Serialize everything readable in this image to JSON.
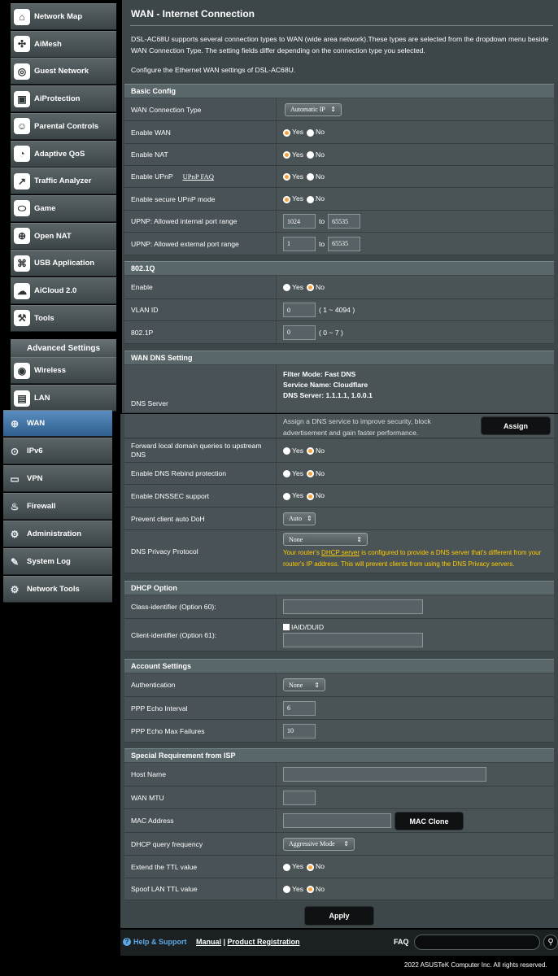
{
  "sidebar_top": [
    {
      "label": "Network Map",
      "icon": "network-map-icon",
      "glyph": "⌂"
    },
    {
      "label": "AiMesh",
      "icon": "aimesh-icon",
      "glyph": "✣"
    },
    {
      "label": "Guest Network",
      "icon": "guest-network-icon",
      "glyph": "◎"
    },
    {
      "label": "AiProtection",
      "icon": "aiprotection-icon",
      "glyph": "▣"
    },
    {
      "label": "Parental Controls",
      "icon": "parental-controls-icon",
      "glyph": "☺"
    },
    {
      "label": "Adaptive QoS",
      "icon": "adaptive-qos-icon",
      "glyph": "◔"
    },
    {
      "label": "Traffic Analyzer",
      "icon": "traffic-analyzer-icon",
      "glyph": "↗"
    },
    {
      "label": "Game",
      "icon": "game-icon",
      "glyph": "⬭"
    },
    {
      "label": "Open NAT",
      "icon": "open-nat-icon",
      "glyph": "⊕"
    },
    {
      "label": "USB Application",
      "icon": "usb-application-icon",
      "glyph": "⌘"
    },
    {
      "label": "AiCloud 2.0",
      "icon": "aicloud-icon",
      "glyph": "☁"
    },
    {
      "label": "Tools",
      "icon": "tools-icon",
      "glyph": "⚒"
    }
  ],
  "advanced_settings": "Advanced Settings",
  "sidebar_adv_top": [
    {
      "label": "Wireless",
      "icon": "wireless-icon",
      "glyph": "◉"
    },
    {
      "label": "LAN",
      "icon": "lan-icon",
      "glyph": "▤"
    }
  ],
  "sidebar_adv": [
    {
      "label": "WAN",
      "icon": "wan-icon",
      "glyph": "⊕",
      "selected": true
    },
    {
      "label": "IPv6",
      "icon": "ipv6-icon",
      "glyph": "⊙"
    },
    {
      "label": "VPN",
      "icon": "vpn-icon",
      "glyph": "▭"
    },
    {
      "label": "Firewall",
      "icon": "firewall-icon",
      "glyph": "♨"
    },
    {
      "label": "Administration",
      "icon": "administration-icon",
      "glyph": "⚙"
    },
    {
      "label": "System Log",
      "icon": "system-log-icon",
      "glyph": "✎"
    },
    {
      "label": "Network Tools",
      "icon": "network-tools-icon",
      "glyph": "⚙"
    }
  ],
  "page_title": "WAN - Internet Connection",
  "description": "DSL-AC68U supports several connection types to WAN (wide area network).These types are selected from the dropdown menu beside WAN Connection Type. The setting fields differ depending on the connection type you selected.",
  "configure_text": "Configure the Ethernet WAN settings of DSL-AC68U.",
  "basic": {
    "title": "Basic Config",
    "wan_type_label": "WAN Connection Type",
    "wan_type_value": "Automatic IP",
    "enable_wan": "Enable WAN",
    "enable_nat": "Enable NAT",
    "enable_upnp": "Enable UPnP",
    "upnp_faq": "UPnP FAQ",
    "secure_upnp": "Enable secure UPnP mode",
    "internal_range": "UPNP: Allowed internal port range",
    "internal_from": "1024",
    "internal_to": "65535",
    "external_range": "UPNP: Allowed external port range",
    "external_from": "1",
    "external_to": "65535",
    "to": "to",
    "yes": "Yes",
    "no": "No"
  },
  "dot1q": {
    "title": "802.1Q",
    "enable": "Enable",
    "vlan_label": "VLAN ID",
    "vlan_value": "0",
    "vlan_hint": "( 1 ~ 4094 )",
    "p_label": "802.1P",
    "p_value": "0",
    "p_hint": "( 0 ~ 7 )"
  },
  "dns": {
    "title": "WAN DNS Setting",
    "server_label": "DNS Server",
    "filter_mode": "Filter Mode: Fast DNS",
    "service_name": "Service Name: Cloudflare",
    "dns_server": "DNS Server: 1.1.1.1, 1.0.0.1",
    "assign_text": "Assign a DNS service to improve security, block advertisement and gain faster performance.",
    "assign_btn": "Assign",
    "forward": "Forward local domain queries to upstream DNS",
    "rebind": "Enable DNS Rebind protection",
    "dnssec": "Enable DNSSEC support",
    "doh": "Prevent client auto DoH",
    "doh_value": "Auto",
    "privacy": "DNS Privacy Protocol",
    "privacy_value": "None",
    "warn_a": "Your router's ",
    "warn_link": "DHCP server",
    "warn_b": " is configured to provide a DNS server that's different from your router's IP address. This will prevent clients from using the DNS Privacy servers."
  },
  "dhcp": {
    "title": "DHCP Option",
    "class_id": "Class-identifier (Option 60):",
    "client_id": "Client-identifier (Option 61):",
    "iaid": "IAID/DUID"
  },
  "account": {
    "title": "Account Settings",
    "auth": "Authentication",
    "auth_value": "None",
    "echo_interval": "PPP Echo Interval",
    "echo_interval_value": "6",
    "echo_fail": "PPP Echo Max Failures",
    "echo_fail_value": "10"
  },
  "isp": {
    "title": "Special Requirement from ISP",
    "host": "Host Name",
    "mtu": "WAN MTU",
    "mac": "MAC Address",
    "mac_clone": "MAC Clone",
    "dhcp_freq": "DHCP query frequency",
    "dhcp_freq_value": "Aggressive Mode",
    "ttl": "Extend the TTL value",
    "spoof": "Spoof LAN TTL value"
  },
  "apply": "Apply",
  "footer": {
    "help": "Help & Support",
    "manual": "Manual",
    "sep": " | ",
    "product": "Product Registration",
    "faq": "FAQ",
    "copyright": "2022 ASUSTeK Computer Inc. All rights reserved."
  }
}
